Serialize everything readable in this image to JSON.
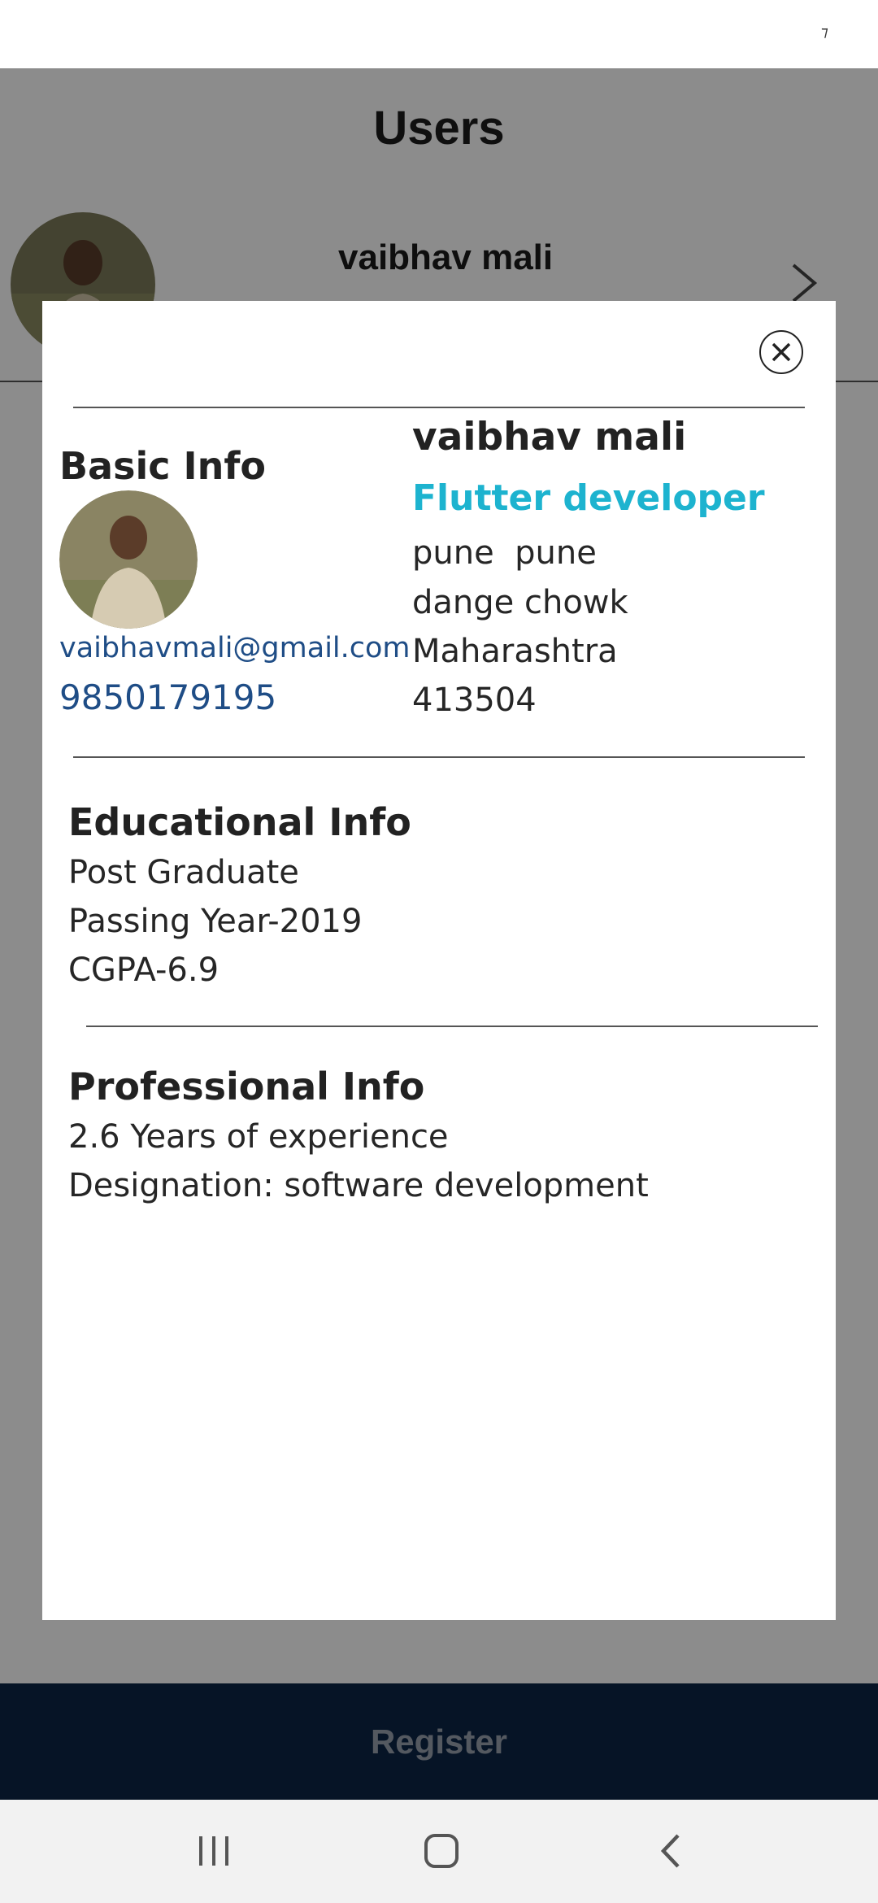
{
  "colors": {
    "navy": "#0b2646",
    "accent_cyan": "#1db3cf",
    "link_blue": "#1f4d86",
    "overlay": "rgba(0,0,0,0.45)"
  },
  "status_bar": {
    "glyph": "⁊"
  },
  "page": {
    "title": "Users"
  },
  "user_row": {
    "name": "vaibhav mali",
    "chevron_icon": "chevron-right-icon"
  },
  "dialog": {
    "close_icon": "close-circle-icon",
    "basic_info": {
      "title": "Basic Info",
      "email": "vaibhavmali@gmail.com",
      "phone": "9850179195"
    },
    "profile": {
      "name": "vaibhav mali",
      "role": "Flutter developer",
      "address_lines": [
        "pune  pune",
        "dange chowk",
        "Maharashtra",
        "413504"
      ]
    },
    "educational_info": {
      "title": "Educational Info",
      "lines": [
        "Post Graduate",
        "Passing Year-2019",
        "CGPA-6.9"
      ]
    },
    "professional_info": {
      "title": "Professional Info",
      "lines": [
        "2.6 Years of experience",
        "Designation: software development"
      ]
    }
  },
  "register_button": {
    "label": "Register"
  },
  "nav_bar": {
    "icons": [
      "recents-icon",
      "home-icon",
      "back-icon"
    ]
  }
}
